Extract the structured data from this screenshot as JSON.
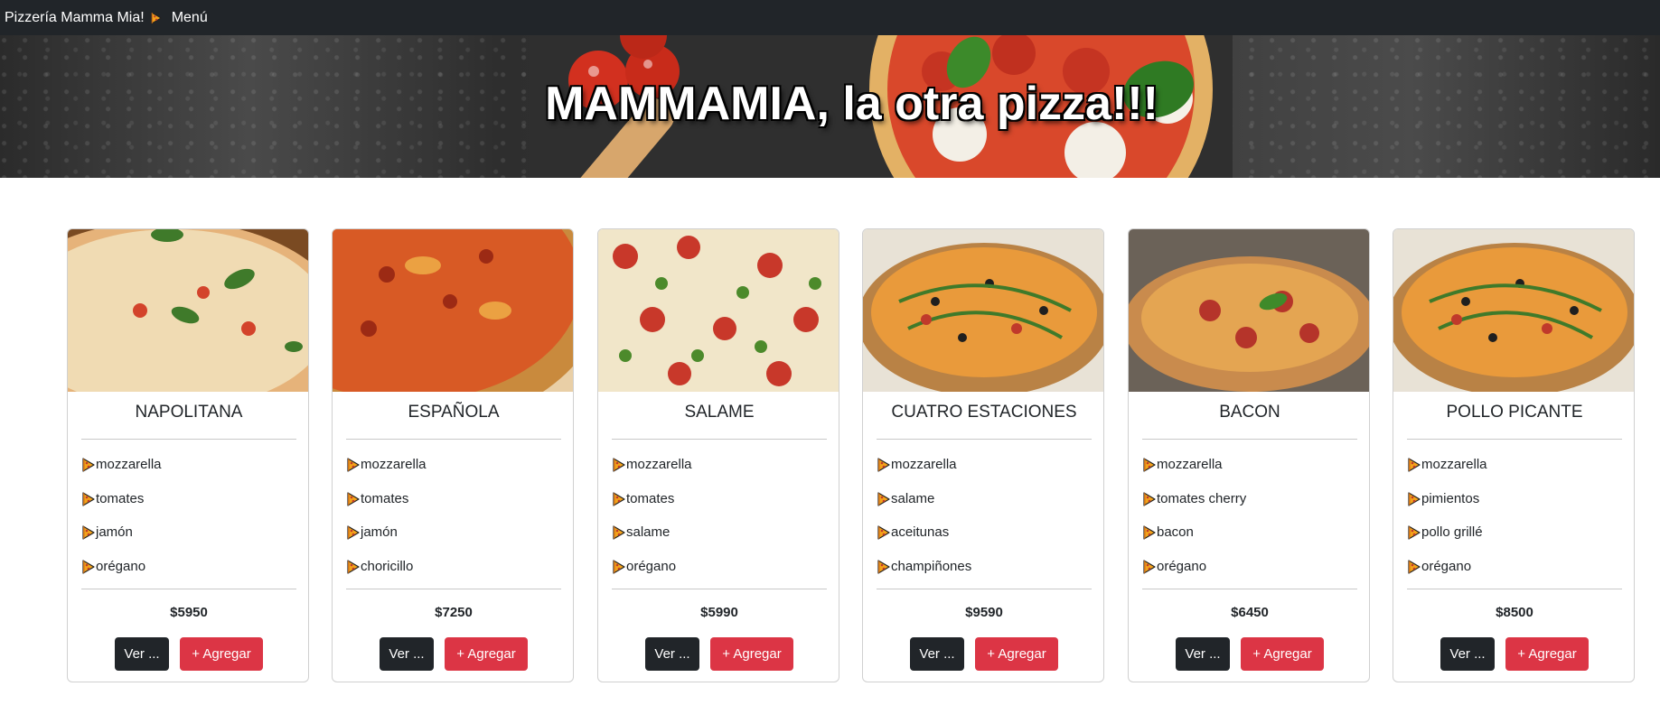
{
  "nav": {
    "brand": "Pizzería Mamma Mia!",
    "menu_label": "Menú",
    "brand_icon": "pizza-slice-icon"
  },
  "hero": {
    "title": "MAMMAMIA, la otra pizza!!!"
  },
  "colors": {
    "navbar": "#212529",
    "ver_button": "#212529",
    "add_button": "#dc3545"
  },
  "pizzas": [
    {
      "name": "NAPOLITANA",
      "ingredients": [
        "mozzarella",
        "tomates",
        "jamón",
        "orégano"
      ],
      "price": "$5950",
      "ver_label": "Ver ...",
      "add_label": "+ Agregar"
    },
    {
      "name": "ESPAÑOLA",
      "ingredients": [
        "mozzarella",
        "tomates",
        "jamón",
        "choricillo"
      ],
      "price": "$7250",
      "ver_label": "Ver ...",
      "add_label": "+ Agregar"
    },
    {
      "name": "SALAME",
      "ingredients": [
        "mozzarella",
        "tomates",
        "salame",
        "orégano"
      ],
      "price": "$5990",
      "ver_label": "Ver ...",
      "add_label": "+ Agregar"
    },
    {
      "name": "CUATRO ESTACIONES",
      "ingredients": [
        "mozzarella",
        "salame",
        "aceitunas",
        "champiñones"
      ],
      "price": "$9590",
      "ver_label": "Ver ...",
      "add_label": "+ Agregar"
    },
    {
      "name": "BACON",
      "ingredients": [
        "mozzarella",
        "tomates cherry",
        "bacon",
        "orégano"
      ],
      "price": "$6450",
      "ver_label": "Ver ...",
      "add_label": "+ Agregar"
    },
    {
      "name": "POLLO PICANTE",
      "ingredients": [
        "mozzarella",
        "pimientos",
        "pollo grillé",
        "orégano"
      ],
      "price": "$8500",
      "ver_label": "Ver ...",
      "add_label": "+ Agregar"
    }
  ]
}
